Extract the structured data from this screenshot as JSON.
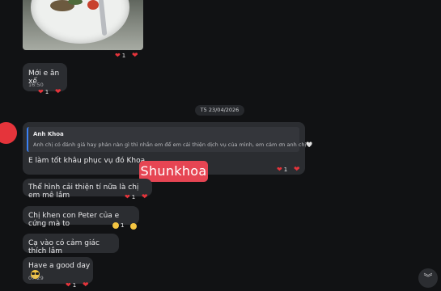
{
  "messages": [
    {
      "text": "Mới e ăn xế",
      "time": "16:50",
      "reaction_count": "1"
    },
    {
      "quote_author": "Anh Khoa",
      "quote_text": "Anh chị có đánh giá hay phản nàn gì thì nhắn em để em cải thiện dịch vụ của mình, em cảm ơn anh chị🤍",
      "text": "E làm tốt khâu phục vụ đó Khoa",
      "reaction_count": "1"
    },
    {
      "text": "Thể hình cải thiện tí nữa là chị em mê lắm",
      "reaction_count": "1"
    },
    {
      "text": "Chị khen con Peter của e cứng mà to",
      "reaction_count": "1"
    },
    {
      "text": "Cạ vào có cảm giác thích lắm"
    },
    {
      "text": "Have a good day",
      "time": "07:29",
      "reaction_count": "1"
    }
  ],
  "photo_reaction_count": "1",
  "date_divider": "T5 23/04/2026",
  "watermark": "Shunkhoa",
  "scroll_down_icon": "chevrons-down-icon",
  "colors": {
    "background": "#111214",
    "bubble": "#2b2d31",
    "heart": "#e5343b",
    "quote_bar": "#3b82f6",
    "watermark_bg": "#e64553"
  }
}
